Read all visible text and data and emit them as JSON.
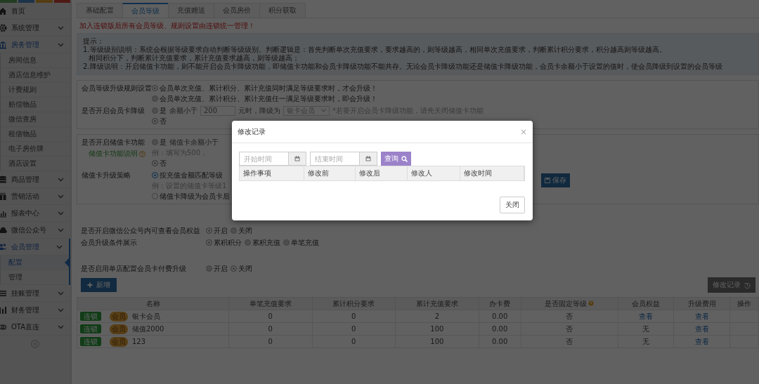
{
  "sidebar": {
    "items": [
      {
        "label": "首页"
      },
      {
        "label": "系统管理",
        "expanded": false
      },
      {
        "label": "房务管理",
        "expanded": true,
        "children": [
          {
            "label": "房间信息",
            "selected": false
          },
          {
            "label": "酒店信息维护",
            "selected": false
          },
          {
            "label": "计费规则",
            "selected": false
          },
          {
            "label": "赔偿物品",
            "selected": false
          },
          {
            "label": "微信查房",
            "selected": false
          },
          {
            "label": "租借物品",
            "selected": false
          },
          {
            "label": "电子房价牌",
            "selected": false
          },
          {
            "label": "酒店设置",
            "selected": false
          }
        ]
      },
      {
        "label": "商品管理",
        "expanded": false
      },
      {
        "label": "营销活动",
        "expanded": false
      },
      {
        "label": "报表中心",
        "expanded": false
      },
      {
        "label": "微信公众号",
        "expanded": false
      },
      {
        "label": "会员管理",
        "expanded": true,
        "children": [
          {
            "label": "配置",
            "selected": true
          },
          {
            "label": "管理",
            "selected": false
          }
        ]
      },
      {
        "label": "挂账管理",
        "expanded": false
      },
      {
        "label": "财务管理",
        "expanded": false
      },
      {
        "label": "OTA直连",
        "expanded": false
      }
    ]
  },
  "tabs": [
    {
      "label": "基础配置",
      "selected": false
    },
    {
      "label": "会员等级",
      "selected": true
    },
    {
      "label": "充值赠送",
      "selected": false
    },
    {
      "label": "会员房价",
      "selected": false
    },
    {
      "label": "积分获取",
      "selected": false
    }
  ],
  "notice": "加入连锁版后所有会员等级、规则设置由连锁统一管理！",
  "tips": [
    "提示：",
    "1.等级级别说明：系统会根据等级要求自动判断等级级别。判断逻辑是：首先判断单次充值要求，要求越高的，则等级越高，相同单次充值要求，判断累计积分要求，积分越高则等级越高。",
    "相同积分下，判断累计充值要求，累计充值要求越高，则等级越高；",
    "2.降级说明：开启储值卡功能，则不能开启会员卡降级功能，即储值卡功能和会员卡降级功能不能共存。无论会员卡降级功能还是储值卡降级功能，会员卡余额小于设置的值时，使会员降级到设置的会员等级"
  ],
  "settings": [
    {
      "kind": "card",
      "rows": [
        {
          "label": "会员等级升级规则设置",
          "lines": [
            {
              "parts": [
                {
                  "kind": "radio",
                  "label": "会员单次充值、累计积分、累计充值同时满足等级要求时，才会升级！",
                  "selected": true,
                  "disabled": true
                }
              ]
            },
            {
              "parts": [
                {
                  "kind": "radio",
                  "label": "会员单次充值、累计积分、累计充值任一满足等级要求时，即会升级！",
                  "selected": false,
                  "disabled": true
                }
              ]
            }
          ]
        },
        {
          "label": "是否开启会员卡降级",
          "lines": [
            {
              "parts": [
                {
                  "kind": "radio",
                  "label": "是",
                  "selected": false,
                  "disabled": true
                },
                {
                  "kind": "text",
                  "text": "余额小于"
                },
                {
                  "kind": "input",
                  "value": "200"
                },
                {
                  "kind": "text",
                  "text": "元时，降级为"
                },
                {
                  "kind": "select",
                  "value": "银卡会员"
                },
                {
                  "kind": "hint",
                  "text": "*若要开启会员卡降级功能，请先关闭储值卡功能"
                }
              ]
            },
            {
              "parts": [
                {
                  "kind": "radio",
                  "label": "否",
                  "selected": true,
                  "disabled": true
                }
              ]
            }
          ]
        }
      ]
    },
    {
      "kind": "card",
      "action": "保存",
      "rows": [
        {
          "label": "是否开启储值卡功能",
          "help": "储值卡功能说明",
          "lines": [
            {
              "parts": [
                {
                  "kind": "radio",
                  "label": "是",
                  "selected": false,
                  "disabled": true
                },
                {
                  "kind": "text",
                  "text": "储值卡余额小于"
                }
              ]
            },
            {
              "parts": [
                {
                  "kind": "hint",
                  "text": "例：填写为500，"
                }
              ]
            },
            {
              "parts": [
                {
                  "kind": "radio",
                  "label": "否",
                  "selected": true,
                  "disabled": true
                }
              ]
            }
          ]
        },
        {
          "label": "储值卡升级策略",
          "lines": [
            {
              "parts": [
                {
                  "kind": "radio",
                  "label": "按充值金额匹配等级",
                  "selected": true,
                  "disabled": false
                }
              ]
            },
            {
              "parts": [
                {
                  "kind": "hint",
                  "text": "例：设置的储值卡等级1"
                }
              ]
            },
            {
              "parts": [
                {
                  "kind": "radio",
                  "label": "储值卡降级为会员卡后",
                  "selected": false,
                  "disabled": false
                }
              ]
            }
          ]
        }
      ]
    },
    {
      "kind": "plain",
      "rows": [
        {
          "label": "是否开启微信公众号内可查看会员权益",
          "lines": [
            {
              "parts": [
                {
                  "kind": "radio",
                  "label": "开启",
                  "selected": true,
                  "disabled": true
                },
                {
                  "kind": "radio",
                  "label": "关闭",
                  "selected": false,
                  "disabled": true
                }
              ]
            }
          ]
        },
        {
          "label": "会员升级条件展示",
          "lines": [
            {
              "parts": [
                {
                  "kind": "radio",
                  "label": "累积积分",
                  "selected": true,
                  "disabled": true
                },
                {
                  "kind": "radio",
                  "label": "累积充值",
                  "selected": false,
                  "disabled": true
                },
                {
                  "kind": "radio",
                  "label": "单笔充值",
                  "selected": false,
                  "disabled": true
                }
              ]
            }
          ]
        }
      ]
    },
    {
      "kind": "plain",
      "rows": [
        {
          "label": "是否启用单店配置会员卡付费升级",
          "lines": [
            {
              "parts": [
                {
                  "kind": "radio",
                  "label": "开启",
                  "selected": false,
                  "disabled": true
                },
                {
                  "kind": "radio",
                  "label": "关闭",
                  "selected": true,
                  "disabled": true
                }
              ]
            }
          ]
        }
      ]
    }
  ],
  "toolbar": {
    "add": "新增",
    "history": "修改记录"
  },
  "table": {
    "columns": [
      {
        "label": "名称"
      },
      {
        "label": "单笔充值要求"
      },
      {
        "label": "累计积分要求"
      },
      {
        "label": "累计充值要求"
      },
      {
        "label": "办卡费"
      },
      {
        "label": "是否固定等级",
        "help": true
      },
      {
        "label": "会员权益"
      },
      {
        "label": "升级费用"
      },
      {
        "label": "操作"
      }
    ],
    "rows": [
      {
        "cells": [
          {
            "kind": "name",
            "tag": "连锁",
            "badge": "会员",
            "text": "银卡会员"
          },
          {
            "kind": "text",
            "text": "0"
          },
          {
            "kind": "text",
            "text": "0"
          },
          {
            "kind": "text",
            "text": "2"
          },
          {
            "kind": "text",
            "text": "0.00"
          },
          {
            "kind": "text",
            "text": "否"
          },
          {
            "kind": "link",
            "text": "查看"
          },
          {
            "kind": "link",
            "text": "查看"
          },
          {
            "kind": "text",
            "text": ""
          }
        ]
      },
      {
        "cells": [
          {
            "kind": "name",
            "tag": "连锁",
            "badge": "会员",
            "text": "储值2000"
          },
          {
            "kind": "text",
            "text": "0"
          },
          {
            "kind": "text",
            "text": "0"
          },
          {
            "kind": "text",
            "text": "100"
          },
          {
            "kind": "text",
            "text": "0.00"
          },
          {
            "kind": "text",
            "text": "否"
          },
          {
            "kind": "text",
            "text": "无"
          },
          {
            "kind": "link",
            "text": "查看"
          },
          {
            "kind": "text",
            "text": ""
          }
        ]
      },
      {
        "cells": [
          {
            "kind": "name",
            "tag": "连锁",
            "badge": "会员",
            "text": "123"
          },
          {
            "kind": "text",
            "text": "0"
          },
          {
            "kind": "text",
            "text": "0"
          },
          {
            "kind": "text",
            "text": "100"
          },
          {
            "kind": "text",
            "text": "0.00"
          },
          {
            "kind": "text",
            "text": "否"
          },
          {
            "kind": "text",
            "text": "无"
          },
          {
            "kind": "link",
            "text": "查看"
          },
          {
            "kind": "text",
            "text": ""
          }
        ]
      }
    ]
  },
  "modal": {
    "title": "修改记录",
    "close": "×",
    "start_placeholder": "开始时间",
    "end_placeholder": "结束时间",
    "search": "查询",
    "columns": [
      "操作事项",
      "修改前",
      "修改后",
      "修改人",
      "修改时间"
    ],
    "footer_button": "关闭"
  }
}
